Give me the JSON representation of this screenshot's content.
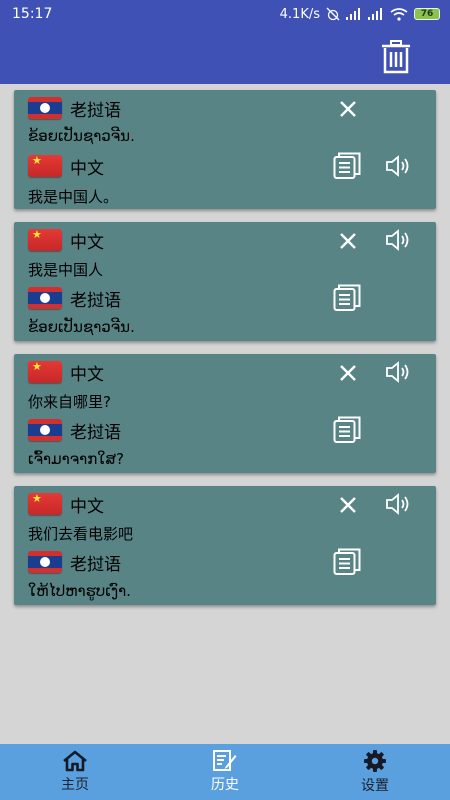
{
  "status_bar": {
    "time": "15:17",
    "net_speed": "4.1K/s",
    "battery": "76"
  },
  "history": [
    {
      "source_lang": "老挝语",
      "source_flag": "la",
      "source_text": "ຂ້ອຍເປັນຊາວຈີນ.",
      "target_lang": "中文",
      "target_flag": "cn",
      "target_text": "我是中国人。",
      "speaker_on": "target"
    },
    {
      "source_lang": "中文",
      "source_flag": "cn",
      "source_text": "我是中国人",
      "target_lang": "老挝语",
      "target_flag": "la",
      "target_text": "ຂ້ອຍເປັນຊາວຈີນ.",
      "speaker_on": "source"
    },
    {
      "source_lang": "中文",
      "source_flag": "cn",
      "source_text": "你来自哪里?",
      "target_lang": "老挝语",
      "target_flag": "la",
      "target_text": "ເຈົ້າມາຈາກໃສ?",
      "speaker_on": "source"
    },
    {
      "source_lang": "中文",
      "source_flag": "cn",
      "source_text": "我们去看电影吧",
      "target_lang": "老挝语",
      "target_flag": "la",
      "target_text": "ໃຫ້ໄປຫາຮູບເງົາ.",
      "speaker_on": "source"
    }
  ],
  "nav": {
    "home": "主页",
    "history": "历史",
    "settings": "设置"
  },
  "colors": {
    "app_bar": "#3f51b5",
    "card": "#588486",
    "nav_bar": "#5aa0de"
  }
}
